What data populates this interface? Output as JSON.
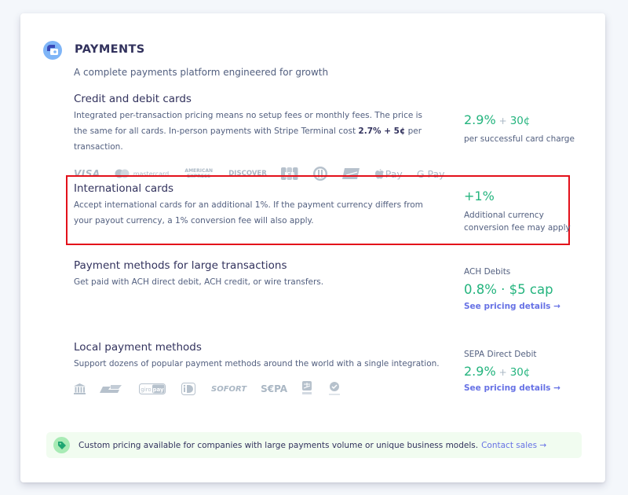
{
  "header": {
    "title": "PAYMENTS",
    "subtitle": "A complete payments platform engineered for growth",
    "icon": "payments-icon"
  },
  "sections": [
    {
      "title": "Credit and debit cards",
      "description_pre": "Integrated per-transaction pricing means no setup fees or monthly fees. The price is the same for all cards. In-person payments with Stripe Terminal cost ",
      "description_bold": "2.7% + 5¢",
      "description_post": " per transaction.",
      "price_percent": "2.9%",
      "price_plus": "+",
      "price_cents": "30¢",
      "note": "per successful card charge",
      "logos": [
        "VISA",
        "mastercard",
        "AMERICAN EXPRESS",
        "DISCOVER",
        "JCB",
        "Diners Club",
        "UnionPay",
        "Apple Pay",
        "G Pay"
      ]
    },
    {
      "title": "International cards",
      "description": "Accept international cards for an additional 1%. If the payment currency differs from your payout currency, a 1% conversion fee will also apply.",
      "price": "+1%",
      "note": "Additional currency conversion fee may apply"
    },
    {
      "title": "Payment methods for large transactions",
      "description": "Get paid with ACH direct debit, ACH credit, or wire transfers.",
      "label": "ACH Debits",
      "price": "0.8% · $5 cap",
      "link": "See pricing details →"
    },
    {
      "title": "Local payment methods",
      "description": "Support dozens of popular payment methods around the world with a single integration.",
      "label": "SEPA Direct Debit",
      "price_percent": "2.9%",
      "price_plus": "+",
      "price_cents": "30¢",
      "link": "See pricing details →",
      "logos": [
        "Bank",
        "Bancontact",
        "giropay",
        "iDEAL",
        "SOFORT",
        "SEPA",
        "Alipay",
        "WeChat Pay"
      ]
    }
  ],
  "banner": {
    "text": "Custom pricing available for companies with large payments volume or unique business models.",
    "link": "Contact sales →"
  },
  "colors": {
    "price_green": "#24b47e",
    "link_purple": "#6772e5",
    "highlight_red": "#e3101a",
    "banner_bg": "#f1fcf0"
  }
}
